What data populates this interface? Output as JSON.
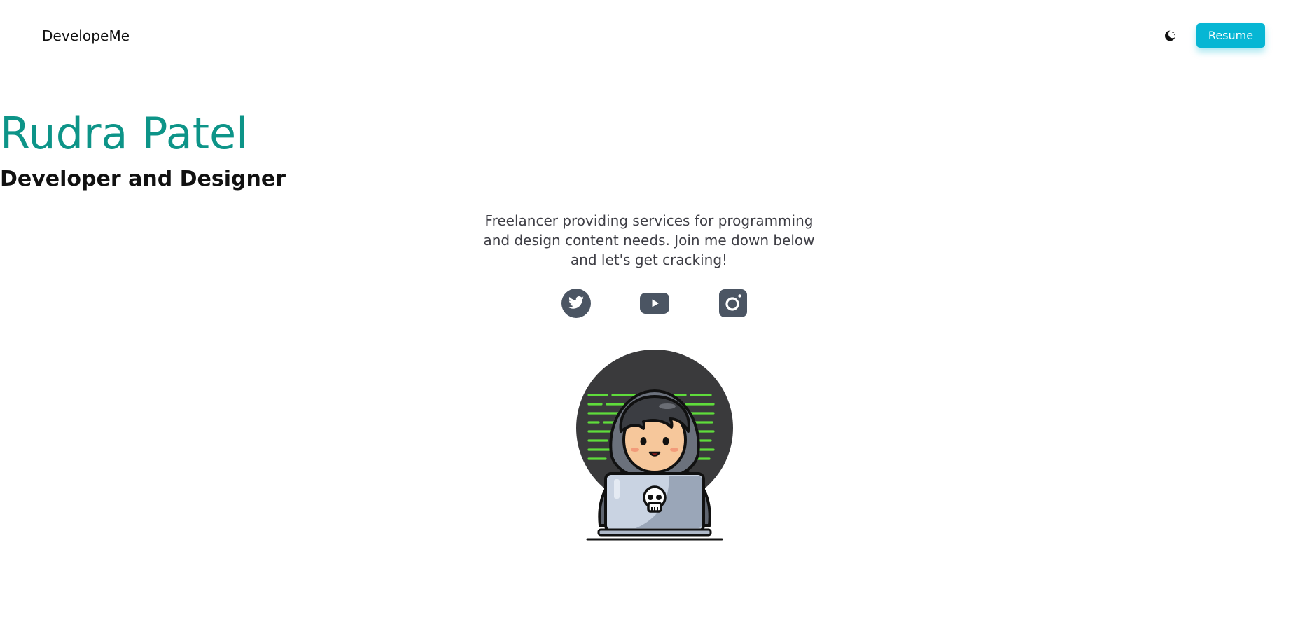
{
  "header": {
    "brand": "DevelopeMe",
    "theme_toggle_icon": "moon-icon",
    "resume_label": "Resume"
  },
  "hero": {
    "name": "Rudra Patel",
    "role": "Developer and Designer",
    "bio": "Freelancer providing services for programming and design content needs. Join me down below and let's get cracking!"
  },
  "socials": [
    {
      "icon": "twitter-icon"
    },
    {
      "icon": "youtube-icon"
    },
    {
      "icon": "instagram-icon"
    }
  ],
  "illustration": {
    "icon": "hacker-at-laptop-illustration"
  },
  "colors": {
    "accent": "#0d9488",
    "button": "#06b6d4",
    "icon": "#4b5563"
  }
}
